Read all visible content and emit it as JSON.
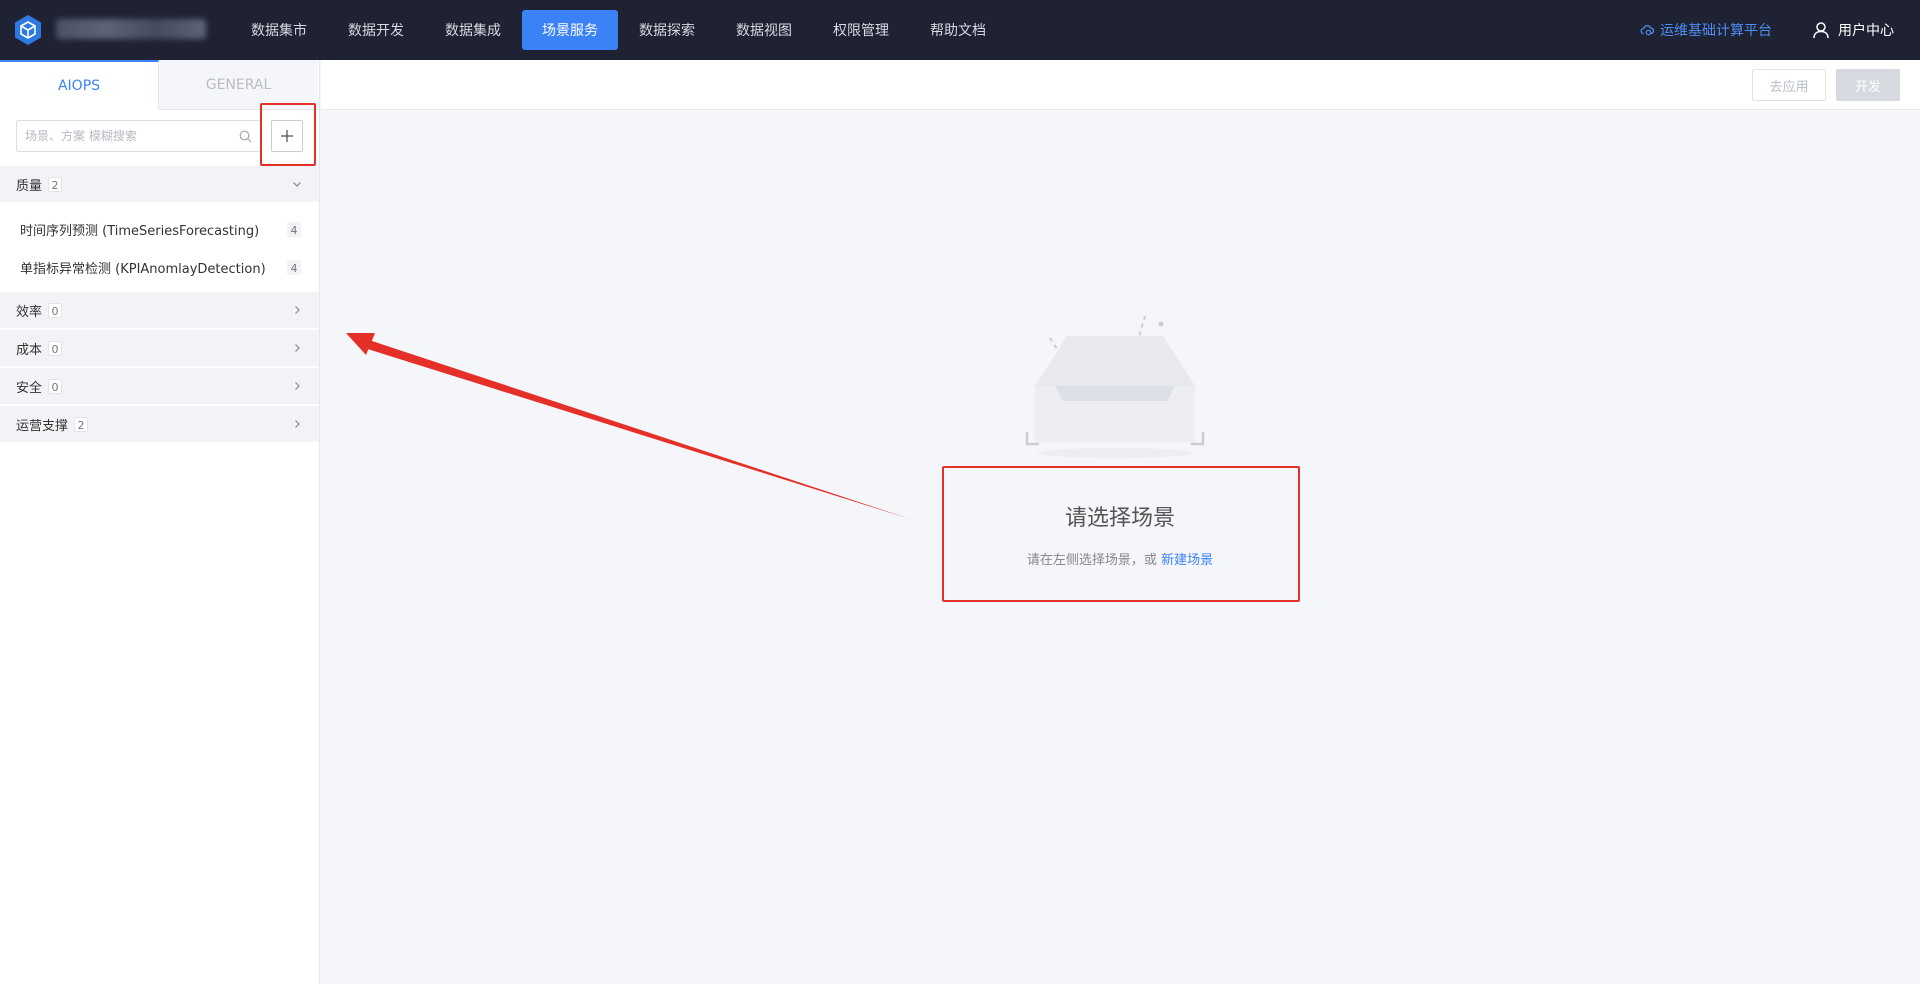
{
  "nav": {
    "items": [
      {
        "label": "数据集市",
        "active": false
      },
      {
        "label": "数据开发",
        "active": false
      },
      {
        "label": "数据集成",
        "active": false
      },
      {
        "label": "场景服务",
        "active": true
      },
      {
        "label": "数据探索",
        "active": false
      },
      {
        "label": "数据视图",
        "active": false
      },
      {
        "label": "权限管理",
        "active": false
      },
      {
        "label": "帮助文档",
        "active": false
      }
    ],
    "platform_link": "运维基础计算平台",
    "user_center": "用户中心"
  },
  "sidebar": {
    "tabs": [
      {
        "label": "AIOPS",
        "active": true
      },
      {
        "label": "GENERAL",
        "active": false
      }
    ],
    "search_placeholder": "场景、方案 模糊搜索",
    "groups": [
      {
        "name": "质量",
        "count": "2",
        "expanded": true,
        "items": [
          {
            "label": "时间序列预测 (TimeSeriesForecasting)",
            "count": "4"
          },
          {
            "label": "单指标异常检测 (KPIAnomlayDetection)",
            "count": "4"
          }
        ]
      },
      {
        "name": "效率",
        "count": "0",
        "expanded": false,
        "items": []
      },
      {
        "name": "成本",
        "count": "0",
        "expanded": false,
        "items": []
      },
      {
        "name": "安全",
        "count": "0",
        "expanded": false,
        "items": []
      },
      {
        "name": "运营支撑",
        "count": "2",
        "expanded": false,
        "items": []
      }
    ]
  },
  "toolbar": {
    "apply_label": "去应用",
    "develop_label": "开发"
  },
  "empty_state": {
    "title": "请选择场景",
    "hint": "请在左侧选择场景，或",
    "link": "新建场景"
  },
  "colors": {
    "nav_bg": "#1f2233",
    "accent": "#3b82f6",
    "annotation": "#e5302a"
  }
}
